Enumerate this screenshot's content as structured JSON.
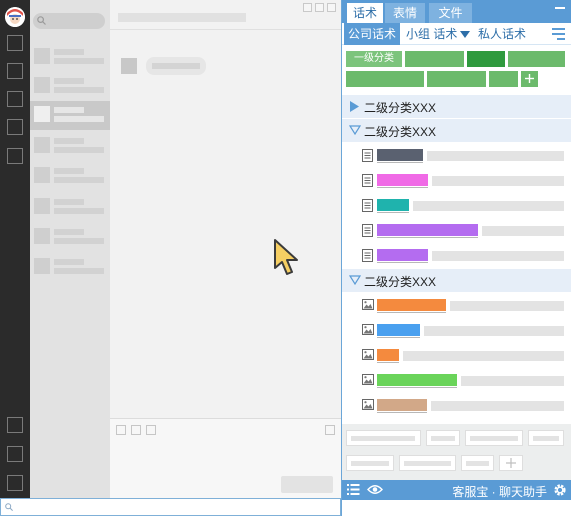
{
  "panel": {
    "tabs": [
      {
        "label": "话术",
        "active": true
      },
      {
        "label": "表情",
        "active": false
      },
      {
        "label": "文件",
        "active": false
      }
    ],
    "subtabs": [
      {
        "label": "公司话术",
        "active": true
      },
      {
        "label": "小组 话术",
        "active": false,
        "has_dropdown": true
      },
      {
        "label": "私人话术",
        "active": false
      }
    ],
    "categories": {
      "first_label": "一级分类",
      "add_icon": "plus-icon"
    },
    "groups": [
      {
        "label": "二级分类XXX",
        "expanded": false
      },
      {
        "label": "二级分类XXX",
        "expanded": true,
        "item_type": "text",
        "colors": [
          "#5a6170",
          "#f06ae6",
          "#1fb3ad",
          "#b46cf0",
          "#b46cf0"
        ]
      },
      {
        "label": "二级分类XXX",
        "expanded": true,
        "item_type": "image",
        "colors": [
          "#f48a3e",
          "#4aa0ef",
          "#f48a3e",
          "#6ad45a",
          "#d2a888"
        ]
      }
    ],
    "footer": {
      "brand": "客服宝 · 聊天助手",
      "icons": [
        "list-icon",
        "eye-icon",
        "gear-icon"
      ]
    },
    "colors": {
      "accent": "#5a9bd5",
      "category_green": "#6cba6c",
      "category_selected": "#2f9a3e",
      "group_bg": "#e6eef8"
    }
  }
}
